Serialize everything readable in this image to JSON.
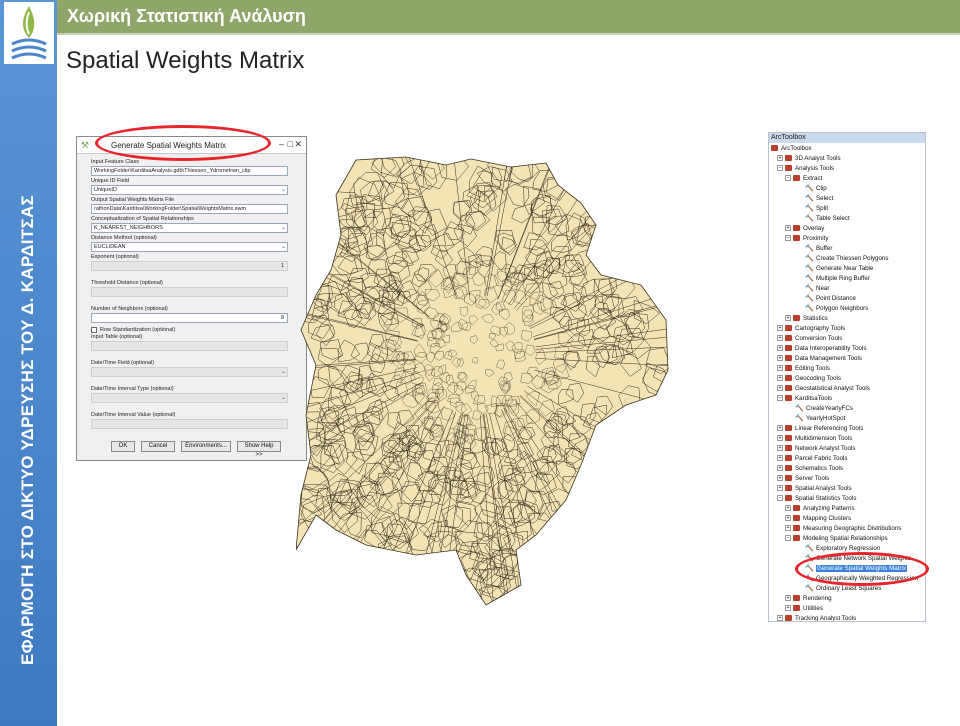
{
  "slide": {
    "header": "Χωρική Στατιστική Ανάλυση",
    "title": "Spatial Weights Matrix",
    "vertical_text": "ΕΦΑΡΜΟΓΗ ΣΤΟ ΔΙΚΤΥΟ ΥΔΡΕΥΣΗΣ ΤΟΥ Δ. ΚΑΡΔΙΤΣΑΣ",
    "header_color": "#8fa56a",
    "sidebar_color": "#4a86cb"
  },
  "dialog": {
    "title": "Generate Spatial Weights Matrix",
    "input_feature_label": "Input Feature Class",
    "input_feature_value": "WorkingFolder\\KarditsaAnalysis.gdb\\Thiessen_Ydrometrwn_clip",
    "unique_id_label": "Unique ID Field",
    "unique_id_value": "UniqueID",
    "output_label": "Output Spatial Weights Matrix File",
    "output_value": "rathonData\\Karditsa\\WorkingFolder\\SpatialWeightsMatrix.swm",
    "concept_label": "Conceptualization of Spatial Relationships",
    "concept_value": "K_NEAREST_NEIGHBORS",
    "distance_label": "Distance Method (optional)",
    "distance_value": "EUCLIDEAN",
    "exponent_label": "Exponent (optional)",
    "exponent_value": "1",
    "threshold_label": "Threshold Distance (optional)",
    "neighbors_label": "Number of Neighbors (optional)",
    "neighbors_value": "8",
    "row_std_label": "Row Standardization (optional)",
    "input_table_label": "Input Table (optional)",
    "dt_field_label": "Date/Time Field (optional)",
    "dt_interval_type_label": "Date/Time Interval Type (optional)",
    "dt_interval_value_label": "Date/Time Interval Value (optional)",
    "buttons": {
      "ok": "OK",
      "cancel": "Cancel",
      "env": "Environments...",
      "help": "Show Help >>"
    }
  },
  "toolbox": {
    "title": "ArcToolbox",
    "items": [
      {
        "label": "ArcToolbox",
        "level": 0,
        "exp": "",
        "icon": "toolbox"
      },
      {
        "label": "3D Analyst Tools",
        "level": 1,
        "exp": "+",
        "icon": "toolbox"
      },
      {
        "label": "Analysis Tools",
        "level": 1,
        "exp": "−",
        "icon": "toolbox"
      },
      {
        "label": "Extract",
        "level": 2,
        "exp": "−",
        "icon": "toolset"
      },
      {
        "label": "Clip",
        "level": 3,
        "exp": "",
        "icon": "tool"
      },
      {
        "label": "Select",
        "level": 3,
        "exp": "",
        "icon": "tool"
      },
      {
        "label": "Split",
        "level": 3,
        "exp": "",
        "icon": "tool"
      },
      {
        "label": "Table Select",
        "level": 3,
        "exp": "",
        "icon": "tool"
      },
      {
        "label": "Overlay",
        "level": 2,
        "exp": "+",
        "icon": "toolset"
      },
      {
        "label": "Proximity",
        "level": 2,
        "exp": "−",
        "icon": "toolset"
      },
      {
        "label": "Buffer",
        "level": 3,
        "exp": "",
        "icon": "tool"
      },
      {
        "label": "Create Thiessen Polygons",
        "level": 3,
        "exp": "",
        "icon": "tool"
      },
      {
        "label": "Generate Near Table",
        "level": 3,
        "exp": "",
        "icon": "tool"
      },
      {
        "label": "Multiple Ring Buffer",
        "level": 3,
        "exp": "",
        "icon": "tool"
      },
      {
        "label": "Near",
        "level": 3,
        "exp": "",
        "icon": "tool"
      },
      {
        "label": "Point Distance",
        "level": 3,
        "exp": "",
        "icon": "tool"
      },
      {
        "label": "Polygon Neighbors",
        "level": 3,
        "exp": "",
        "icon": "tool"
      },
      {
        "label": "Statistics",
        "level": 2,
        "exp": "+",
        "icon": "toolset"
      },
      {
        "label": "Cartography Tools",
        "level": 1,
        "exp": "+",
        "icon": "toolbox"
      },
      {
        "label": "Conversion Tools",
        "level": 1,
        "exp": "+",
        "icon": "toolbox"
      },
      {
        "label": "Data Interoperability Tools",
        "level": 1,
        "exp": "+",
        "icon": "toolbox"
      },
      {
        "label": "Data Management Tools",
        "level": 1,
        "exp": "+",
        "icon": "toolbox"
      },
      {
        "label": "Editing Tools",
        "level": 1,
        "exp": "+",
        "icon": "toolbox"
      },
      {
        "label": "Geocoding Tools",
        "level": 1,
        "exp": "+",
        "icon": "toolbox"
      },
      {
        "label": "Geostatistical Analyst Tools",
        "level": 1,
        "exp": "+",
        "icon": "toolbox"
      },
      {
        "label": "KarditsaTools",
        "level": 1,
        "exp": "−",
        "icon": "toolbox"
      },
      {
        "label": "CreateYearlyFCs",
        "level": 2,
        "exp": "",
        "icon": "tool"
      },
      {
        "label": "YearlyHotSpot",
        "level": 2,
        "exp": "",
        "icon": "tool"
      },
      {
        "label": "Linear Referencing Tools",
        "level": 1,
        "exp": "+",
        "icon": "toolbox"
      },
      {
        "label": "Multidimension Tools",
        "level": 1,
        "exp": "+",
        "icon": "toolbox"
      },
      {
        "label": "Network Analyst Tools",
        "level": 1,
        "exp": "+",
        "icon": "toolbox"
      },
      {
        "label": "Parcel Fabric Tools",
        "level": 1,
        "exp": "+",
        "icon": "toolbox"
      },
      {
        "label": "Schematics Tools",
        "level": 1,
        "exp": "+",
        "icon": "toolbox"
      },
      {
        "label": "Server Tools",
        "level": 1,
        "exp": "+",
        "icon": "toolbox"
      },
      {
        "label": "Spatial Analyst Tools",
        "level": 1,
        "exp": "+",
        "icon": "toolbox"
      },
      {
        "label": "Spatial Statistics Tools",
        "level": 1,
        "exp": "−",
        "icon": "toolbox"
      },
      {
        "label": "Analyzing Patterns",
        "level": 2,
        "exp": "+",
        "icon": "toolset"
      },
      {
        "label": "Mapping Clusters",
        "level": 2,
        "exp": "+",
        "icon": "toolset"
      },
      {
        "label": "Measuring Geographic Distributions",
        "level": 2,
        "exp": "+",
        "icon": "toolset"
      },
      {
        "label": "Modeling Spatial Relationships",
        "level": 2,
        "exp": "−",
        "icon": "toolset"
      },
      {
        "label": "Exploratory Regression",
        "level": 3,
        "exp": "",
        "icon": "tool"
      },
      {
        "label": "Generate Network Spatial Weights",
        "level": 3,
        "exp": "",
        "icon": "tool"
      },
      {
        "label": "Generate Spatial Weights Matrix",
        "level": 3,
        "exp": "",
        "icon": "tool",
        "selected": true
      },
      {
        "label": "Geographically Weighted Regression",
        "level": 3,
        "exp": "",
        "icon": "tool"
      },
      {
        "label": "Ordinary Least Squares",
        "level": 3,
        "exp": "",
        "icon": "tool"
      },
      {
        "label": "Rendering",
        "level": 2,
        "exp": "+",
        "icon": "toolset"
      },
      {
        "label": "Utilities",
        "level": 2,
        "exp": "+",
        "icon": "toolset"
      },
      {
        "label": "Tracking Analyst Tools",
        "level": 1,
        "exp": "+",
        "icon": "toolbox"
      }
    ]
  },
  "map": {
    "fill": "#f4e3b5",
    "stroke": "#3a3020",
    "shape": "thiessen-polygons-map"
  },
  "highlight_color": "#e8252b"
}
